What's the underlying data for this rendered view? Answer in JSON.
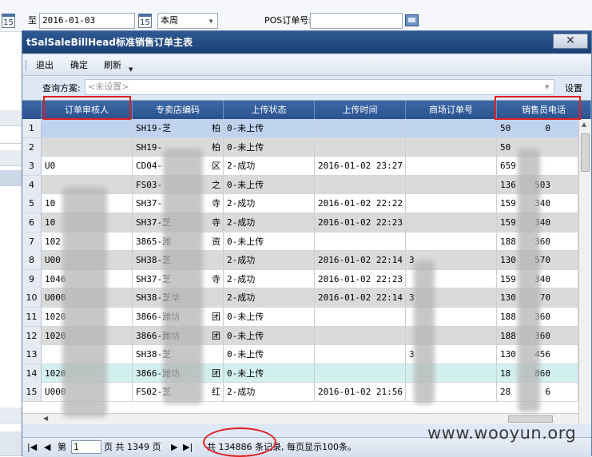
{
  "filter_bar": {
    "to_label": "至",
    "date_value": "2016-01-03",
    "period_value": "本周",
    "pos_label": "POS订单号:",
    "pos_value": "",
    "cal_day": "15"
  },
  "window": {
    "title": "tSalSaleBillHead标准销售订单主表",
    "close_symbol": "✕"
  },
  "toolbar": {
    "exit_label": "退出",
    "confirm_label": "确定",
    "refresh_label": "刷新"
  },
  "query": {
    "label": "查询方案:",
    "placeholder": "<未设置>",
    "settings_label": "设置"
  },
  "table": {
    "columns": [
      "订单审核人",
      "专卖店编码",
      "上传状态",
      "上传时间",
      "商场订单号",
      "销售员电话"
    ],
    "rows": [
      {
        "num": "1",
        "reviewer": "",
        "store": "SH19-芝",
        "store_tail": "柏",
        "status": "0-未上传",
        "time": "",
        "mall": "",
        "phone": "50",
        "phone_tail": "0"
      },
      {
        "num": "2",
        "reviewer": "",
        "store": "SH19-",
        "store_tail": "柏",
        "status": "0-未上传",
        "time": "",
        "mall": "",
        "phone": "50",
        "phone_tail": ""
      },
      {
        "num": "3",
        "reviewer": "U0",
        "store": "CD04-",
        "store_tail": "区",
        "status": "2-成功",
        "time": "2016-01-02 23:27",
        "mall": "",
        "phone": "659",
        "phone_tail": ""
      },
      {
        "num": "4",
        "reviewer": "",
        "store": "FS03-",
        "store_tail": "之",
        "status": "0-未上传",
        "time": "",
        "mall": "",
        "phone": "136",
        "phone_tail": "503"
      },
      {
        "num": "5",
        "reviewer": "10",
        "store": "SH37-",
        "store_tail": "寺",
        "status": "2-成功",
        "time": "2016-01-02 22:22",
        "mall": "",
        "phone": "159",
        "phone_tail": "340"
      },
      {
        "num": "6",
        "reviewer": "10",
        "store": "SH37-芝",
        "store_tail": "寺",
        "status": "2-成功",
        "time": "2016-01-02 22:23",
        "mall": "",
        "phone": "159",
        "phone_tail": "340"
      },
      {
        "num": "7",
        "reviewer": "102",
        "store": "3865-潍",
        "store_tail": "资",
        "status": "0-未上传",
        "time": "",
        "mall": "",
        "phone": "188",
        "phone_tail": "360"
      },
      {
        "num": "8",
        "reviewer": "U00",
        "store": "SH38-芝",
        "store_tail": "",
        "status": "2-成功",
        "time": "2016-01-02 22:14",
        "mall": "3",
        "phone": "130",
        "phone_tail": "570"
      },
      {
        "num": "9",
        "reviewer": "1046",
        "store": "SH37-芝",
        "store_tail": "寺",
        "status": "2-成功",
        "time": "2016-01-02 22:23",
        "mall": "",
        "phone": "159",
        "phone_tail": "340"
      },
      {
        "num": "10",
        "reviewer": "U000",
        "store": "SH38-芝华",
        "store_tail": "",
        "status": "2-成功",
        "time": "2016-01-02 22:14",
        "mall": "3",
        "phone": "130",
        "phone_tail": "70"
      },
      {
        "num": "11",
        "reviewer": "1020",
        "store": "3866-潍坊",
        "store_tail": "团",
        "status": "0-未上传",
        "time": "",
        "mall": "",
        "phone": "188",
        "phone_tail": "360"
      },
      {
        "num": "12",
        "reviewer": "1020",
        "store": "3866-潍坊",
        "store_tail": "团",
        "status": "0-未上传",
        "time": "",
        "mall": "",
        "phone": "188",
        "phone_tail": "360"
      },
      {
        "num": "13",
        "reviewer": "",
        "store": "SH38-芝",
        "store_tail": "",
        "status": "0-未上传",
        "time": "",
        "mall": "3",
        "phone": "130",
        "phone_tail": "456"
      },
      {
        "num": "14",
        "reviewer": "1020",
        "store": "3866-潍坊",
        "store_tail": "团",
        "status": "0-未上传",
        "time": "",
        "mall": "",
        "phone": "18",
        "phone_tail": "860"
      },
      {
        "num": "15",
        "reviewer": "U000",
        "store": "FS02-芝",
        "store_tail": "红",
        "status": "2-成功",
        "time": "2016-01-02 21:56",
        "mall": "",
        "phone": "28",
        "phone_tail": "6"
      }
    ]
  },
  "pager": {
    "page_label": "第",
    "page_value": "1",
    "page_of": "页 共 1349 页",
    "total_text": "共 134886 条记录, 每页显示100条。"
  },
  "watermark": "www.wooyun.org",
  "colors": {
    "title_bg": "#1f457c",
    "header_bg": "#3560a0",
    "highlight": "#e02020"
  }
}
